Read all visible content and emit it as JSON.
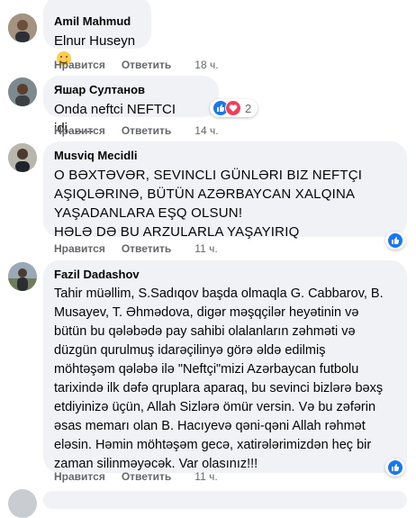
{
  "comments": [
    {
      "author": "Amil Mahmud",
      "text": "Elnur Huseyn",
      "emoji": "smirk-emoji",
      "like": "Нравится",
      "reply": "Ответить",
      "time": "18 ч."
    },
    {
      "author": "Яшар Султанов",
      "text": "Onda neftci NEFTCI idi.......",
      "like": "Нравится",
      "reply": "Ответить",
      "time": "14 ч.",
      "reactions": "2"
    },
    {
      "author": "Musviq Mecidli",
      "text": "O BƏXTƏVƏR, SEVINCLI GÜNLƏRI BIZ NEFTÇI\nAŞIQLƏRINƏ, BÜTÜN AZƏRBAYCAN XALQINA\nYAŞADANLARA EŞQ OLSUN!\nHƏLƏ DƏ BU ARZULARLA YAŞAYIRIQ",
      "like": "Нравится",
      "reply": "Ответить",
      "time": "11 ч."
    },
    {
      "author": "Fazil Dadashov",
      "text": "Tahir müəllim, S.Sadıqov başda olmaqla G. Cabbarov, B.\nMusayev, T. Əhmədova, digər məşqçilər heyətinin və\nbütün bu qələbədə pay sahibi olalanların zəhməti və\ndüzgün qurulmuş idarəçilinyə görə əldə edilmiş\nmöhtəşəm qələbə ilə \"Neftçi\"mizi Azərbaycan futbolu\ntarixində ilk dəfə qruplara aparaq, bu sevinci bizlərə bəxş\netdiyinizə üçün, Allah Sizlərə ömür versin. Və bu zəfərin\nəsas memarı olan B. Hacıyevə qəni-qəni Allah rəhmət\neləsin. Həmin möhtəşəm gecə, xatirələrimizdən heç bir\nzaman silinməyəcək. Var olasınız!!!",
      "like": "Нравится",
      "reply": "Ответить",
      "time": "11 ч."
    }
  ],
  "colors": {
    "bubble": "#f0f2f5",
    "link": "#65676b",
    "like": "#1877f2",
    "love": "#f33e58"
  }
}
